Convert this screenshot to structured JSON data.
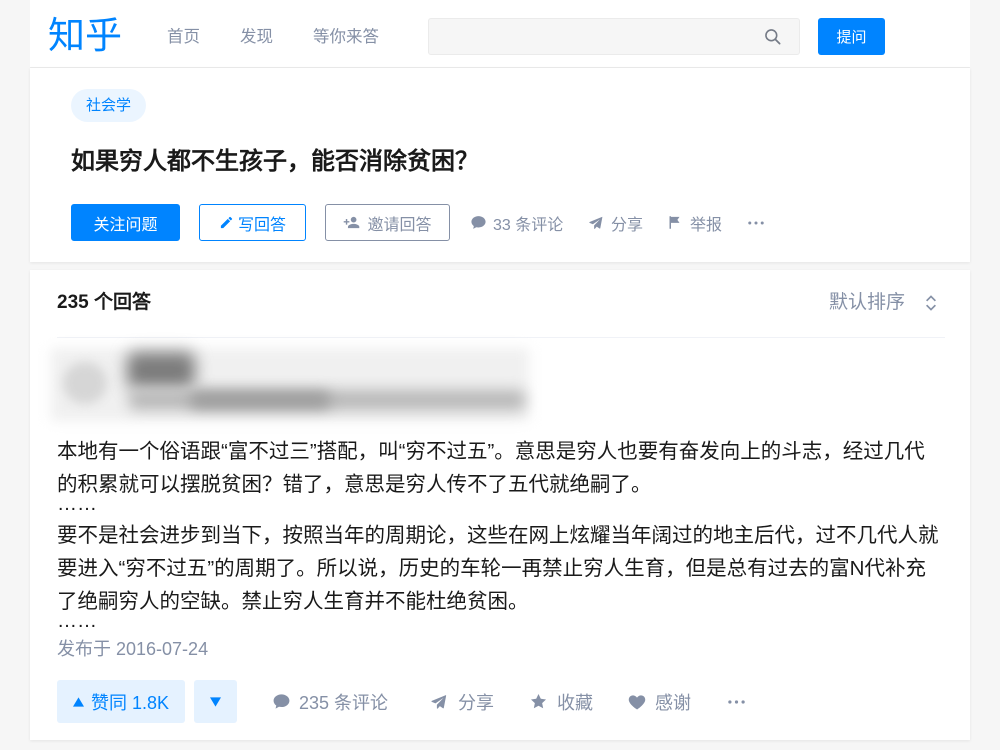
{
  "header": {
    "logo": "知乎",
    "nav": [
      {
        "label": "首页"
      },
      {
        "label": "发现"
      },
      {
        "label": "等你来答"
      }
    ],
    "search": {
      "icon": "search-icon"
    },
    "ask_button": "提问"
  },
  "question": {
    "topic": "社会学",
    "title": "如果穷人都不生孩子，能否消除贫困？",
    "actions": {
      "follow": {
        "label": "关注问题"
      },
      "write_answer": {
        "label": "写回答",
        "icon": "pencil-icon"
      },
      "invite": {
        "label": "邀请回答",
        "icon": "invite-user-icon"
      },
      "comments": {
        "label": "33 条评论",
        "icon": "comment-icon"
      },
      "share": {
        "label": "分享",
        "icon": "share-icon"
      },
      "report": {
        "label": "举报",
        "icon": "flag-icon"
      },
      "more": {
        "icon": "more-icon"
      }
    }
  },
  "answer_list": {
    "count_label": "235 个回答",
    "sort_label": "默认排序",
    "sort_icon": "sort-chevrons-icon",
    "answer": {
      "paragraphs": [
        {
          "lines": [
            "本地有一个俗语跟“富不过三”搭配，叫“穷不过五”。意思是穷人也要有奋发向上的斗志，经过几代",
            "的积累就可以摆脱贫困？错了，意思是穷人传不了五代就绝嗣了。"
          ],
          "ellipsis": "……"
        },
        {
          "lines": [
            "要不是社会进步到当下，按照当年的周期论，这些在网上炫耀当年阔过的地主后代，过不几代人就",
            "要进入“穷不过五”的周期了。所以说，历史的车轮一再禁止穷人生育，但是总有过去的富N代补充",
            "了绝嗣穷人的空缺。禁止穷人生育并不能杜绝贫困。"
          ],
          "ellipsis": "……"
        }
      ],
      "published": "发布于 2016-07-24",
      "actions": {
        "upvote": {
          "label": "赞同 1.8K",
          "icon": "upvote-triangle-icon"
        },
        "downvote": {
          "icon": "downvote-triangle-icon"
        },
        "comments": {
          "label": "235 条评论",
          "icon": "comment-icon"
        },
        "share": {
          "label": "分享",
          "icon": "share-icon"
        },
        "favorite": {
          "label": "收藏",
          "icon": "star-icon"
        },
        "thanks": {
          "label": "感谢",
          "icon": "heart-icon"
        },
        "more": {
          "icon": "more-icon"
        }
      }
    }
  },
  "colors": {
    "brand": "#0084ff",
    "brand_light": "#e5f2ff",
    "tag_bg": "#ebf5ff",
    "muted": "#8590a6",
    "text": "#1a1a1a",
    "page_bg": "#f6f6f6"
  }
}
